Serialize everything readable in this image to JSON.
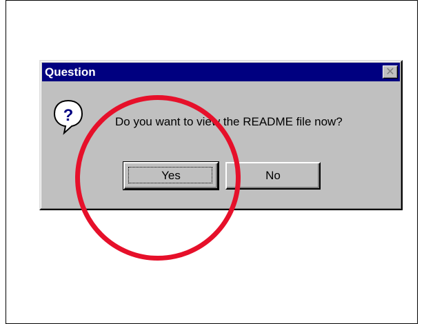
{
  "dialog": {
    "title": "Question",
    "close_icon": "close-icon",
    "message": "Do you want to view the README file now?",
    "icon": "question-icon"
  },
  "buttons": {
    "yes_label": "Yes",
    "no_label": "No"
  },
  "colors": {
    "titlebar": "#000080",
    "dialog_bg": "#c0c0c0",
    "highlight_circle": "#e6102a"
  }
}
